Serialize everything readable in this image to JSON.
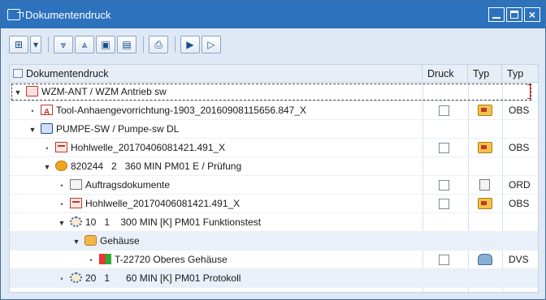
{
  "window": {
    "title": "Dokumentendruck"
  },
  "toolbar": {
    "buttons": [
      "expand-all",
      "dropdown",
      "sort-descending",
      "sort-ascending",
      "filter",
      "select-all",
      "print",
      "export",
      "find"
    ]
  },
  "grid": {
    "columns": [
      "Dokumentendruck",
      "Druck",
      "Typ",
      "Typ"
    ],
    "rows": [
      {
        "level": 0,
        "toggle": "open",
        "icon": "network-icon",
        "text": "WZM-ANT / WZM Antrieb sw",
        "checkbox": false,
        "typ_icon": "",
        "typ": "",
        "selected": true
      },
      {
        "level": 1,
        "toggle": "leaf",
        "icon": "pdf-icon",
        "text": "Tool-Anhaengevorrichtung-1903_20160908115656.847_X",
        "checkbox": true,
        "typ_icon": "document-relation-icon",
        "typ": "OBS"
      },
      {
        "level": 1,
        "toggle": "open",
        "icon": "machine-icon",
        "text": "PUMPE-SW / Pumpe-sw DL",
        "checkbox": false,
        "typ_icon": "",
        "typ": ""
      },
      {
        "level": 2,
        "toggle": "leaf",
        "icon": "document-icon",
        "text": "Hohlwelle_20170406081421.491_X",
        "checkbox": true,
        "typ_icon": "document-relation-icon",
        "typ": "OBS"
      },
      {
        "level": 2,
        "toggle": "open",
        "icon": "operation-icon",
        "text": "820244   2   360 MIN PM01 E / Prüfung",
        "checkbox": false,
        "typ_icon": "",
        "typ": ""
      },
      {
        "level": 3,
        "toggle": "leaf",
        "icon": "list-icon",
        "text": "Auftragsdokumente",
        "checkbox": true,
        "typ_icon": "order-document-icon",
        "typ": "ORD"
      },
      {
        "level": 3,
        "toggle": "leaf",
        "icon": "document-icon",
        "text": "Hohlwelle_20170406081421.491_X",
        "checkbox": true,
        "typ_icon": "document-relation-icon",
        "typ": "OBS"
      },
      {
        "level": 3,
        "toggle": "open",
        "icon": "gear-icon",
        "text": "10   1    300 MIN [K] PM01 Funktionstest",
        "checkbox": false,
        "typ_icon": "",
        "typ": ""
      },
      {
        "level": 4,
        "toggle": "open",
        "icon": "component-icon",
        "text": "Gehäuse",
        "checkbox": false,
        "typ_icon": "",
        "typ": "",
        "blue": true
      },
      {
        "level": 5,
        "toggle": "leaf",
        "icon": "windows-icon",
        "text": "T-22720 Oberes Gehäuse",
        "checkbox": true,
        "typ_icon": "dvs-icon",
        "typ": "DVS"
      },
      {
        "level": 3,
        "toggle": "leaf",
        "icon": "gear-icon",
        "text": "20   1      60 MIN [K] PM01 Protokoll",
        "checkbox": false,
        "typ_icon": "",
        "typ": "",
        "blue": true
      }
    ]
  }
}
